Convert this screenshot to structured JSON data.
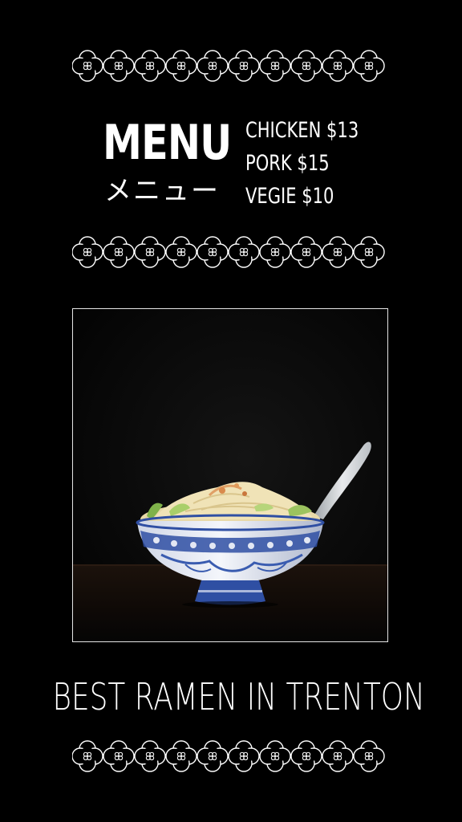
{
  "menu": {
    "title": "MENU",
    "title_jp": "メニュー",
    "items": [
      {
        "label": "CHICKEN $13"
      },
      {
        "label": "PORK $15"
      },
      {
        "label": "VEGIE $10"
      }
    ]
  },
  "tagline": "BEST RAMEN IN TRENTON",
  "photo": {
    "icon": "ramen-bowl-photo"
  },
  "decor": {
    "icon": "flower-ornament-icon",
    "color": "#ffffff"
  },
  "colors": {
    "background": "#000000",
    "text": "#ffffff",
    "bowl_blue": "#2f4fa3"
  }
}
